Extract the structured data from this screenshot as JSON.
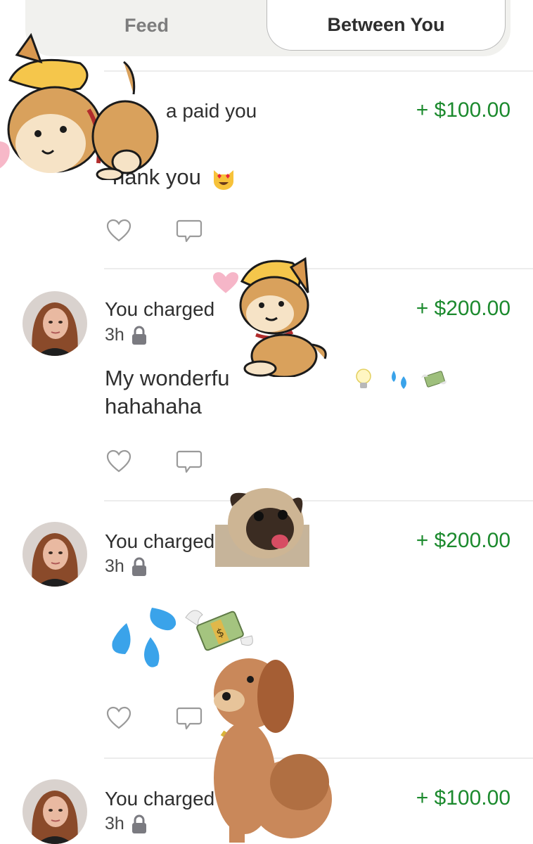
{
  "tabs": [
    {
      "label": "Feed",
      "active": false
    },
    {
      "label": "Between You",
      "active": true
    }
  ],
  "transactions": [
    {
      "who": "a paid you",
      "amount": "+ $100.00",
      "time": "",
      "note_line1": "hank you",
      "note_emoji": "smiling-cat-heart-eyes"
    },
    {
      "who": "You charged",
      "amount": "+ $200.00",
      "time": "3h",
      "note_line1": "My wonderfu",
      "note_line2": "hahahaha",
      "note_emojis": [
        "light-bulb",
        "sweat-droplets",
        "money-with-wings"
      ]
    },
    {
      "who": "You charged",
      "amount": "+ $200.00",
      "time": "3h",
      "note_emojis": [
        "sweat-droplets",
        "money-with-wings"
      ]
    },
    {
      "who": "You charged",
      "amount": "+ $100.00",
      "time": "3h"
    }
  ],
  "colors": {
    "amount_green": "#1c8a2e",
    "tab_background": "#f1f1ee",
    "divider": "#ececec"
  },
  "icons": [
    "heart-icon",
    "comment-icon",
    "lock-icon",
    "avatar"
  ],
  "stickers": [
    "shiba-hat-sticker",
    "shiba-hat-sticker-sitting",
    "pink-heart-sticker",
    "pug-sticker",
    "pixel-dog-sticker"
  ]
}
